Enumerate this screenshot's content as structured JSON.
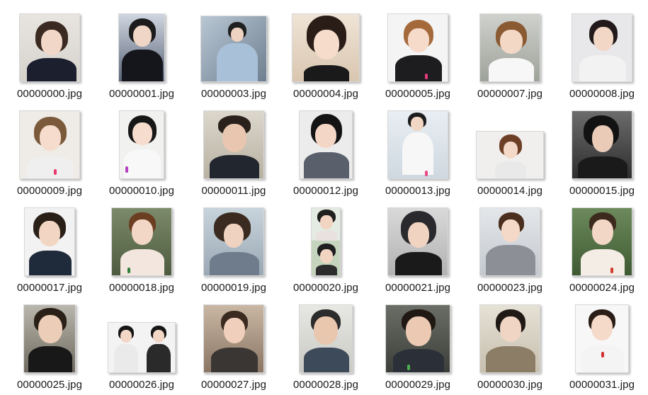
{
  "window": {
    "view": "Large icons"
  },
  "files": [
    {
      "name": "00000000.jpg"
    },
    {
      "name": "00000001.jpg"
    },
    {
      "name": "00000003.jpg"
    },
    {
      "name": "00000004.jpg"
    },
    {
      "name": "00000005.jpg"
    },
    {
      "name": "00000007.jpg"
    },
    {
      "name": "00000008.jpg"
    },
    {
      "name": "00000009.jpg"
    },
    {
      "name": "00000010.jpg"
    },
    {
      "name": "00000011.jpg"
    },
    {
      "name": "00000012.jpg"
    },
    {
      "name": "00000013.jpg"
    },
    {
      "name": "00000014.jpg"
    },
    {
      "name": "00000015.jpg"
    },
    {
      "name": "00000017.jpg"
    },
    {
      "name": "00000018.jpg"
    },
    {
      "name": "00000019.jpg"
    },
    {
      "name": "00000020.jpg"
    },
    {
      "name": "00000021.jpg"
    },
    {
      "name": "00000023.jpg"
    },
    {
      "name": "00000024.jpg"
    },
    {
      "name": "00000025.jpg"
    },
    {
      "name": "00000026.jpg"
    },
    {
      "name": "00000027.jpg"
    },
    {
      "name": "00000028.jpg"
    },
    {
      "name": "00000029.jpg"
    },
    {
      "name": "00000030.jpg"
    },
    {
      "name": "00000031.jpg"
    }
  ]
}
